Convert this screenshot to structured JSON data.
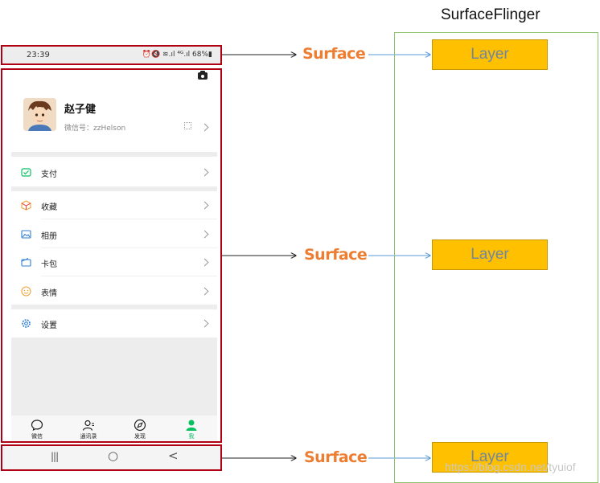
{
  "phone": {
    "status_bar": {
      "time": "23:39",
      "icons": "⏰🔇 ≋.ıl ⁴ᴳ.ıl 68%▮",
      "battery": "68%"
    },
    "profile": {
      "name": "赵子健",
      "wechat_id": "微信号：zzHelson"
    },
    "menu": [
      {
        "label": "支付",
        "icon": "pay-icon"
      },
      {
        "label": "收藏",
        "icon": "favorites-icon"
      },
      {
        "label": "相册",
        "icon": "album-icon"
      },
      {
        "label": "卡包",
        "icon": "card-wallet-icon"
      },
      {
        "label": "表情",
        "icon": "sticker-icon"
      },
      {
        "label": "设置",
        "icon": "settings-icon"
      }
    ],
    "tabs": [
      {
        "label": "微信",
        "icon": "chat-icon",
        "active": false
      },
      {
        "label": "通讯录",
        "icon": "contacts-icon",
        "active": false
      },
      {
        "label": "发现",
        "icon": "discover-icon",
        "active": false
      },
      {
        "label": "我",
        "icon": "me-icon",
        "active": true
      }
    ],
    "nav_bar": {
      "recent": "|||",
      "home": "○",
      "back": "<"
    }
  },
  "diagram": {
    "surface_labels": [
      "Surface",
      "Surface",
      "Surface"
    ],
    "compositor_title": "SurfaceFlinger",
    "layer_labels": [
      "Layer",
      "Layer",
      "Layer"
    ]
  },
  "watermark": "https://blog.csdn.net/tyuiof",
  "colors": {
    "frame_red": "#b00014",
    "surface_orange": "#ed7d31",
    "layer_fill": "#ffc000",
    "layer_text": "#6f86a8",
    "flinger_border": "#8dc26f",
    "arrow_blue": "#5b9bd5",
    "wechat_green": "#07c160"
  }
}
